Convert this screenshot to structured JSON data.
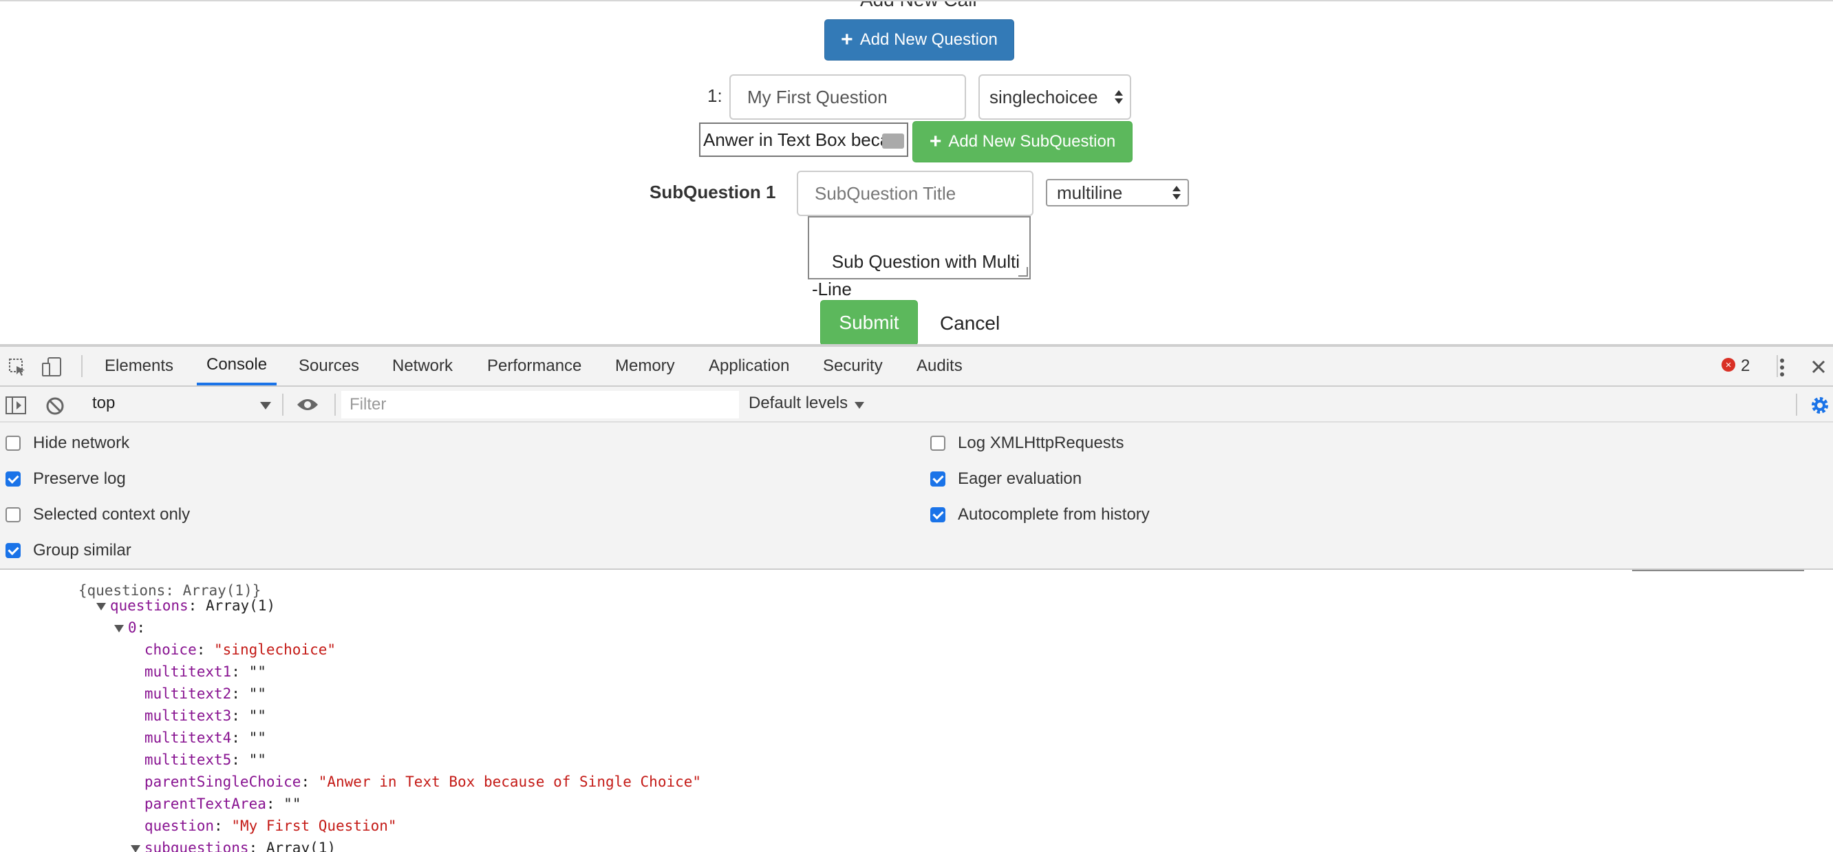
{
  "page": {
    "cut_heading": "Add New Call",
    "add_question_label": "Add New Question",
    "question_number": "1:",
    "question_title_value": "My First Question",
    "question_type_value": "singlechoicee",
    "answer_value": "Anwer in Text Box beca",
    "add_subquestion_label": "Add New SubQuestion",
    "subquestion_label": "SubQuestion 1",
    "subquestion_title_placeholder": "SubQuestion Title",
    "subquestion_type_value": "multiline",
    "subquestion_textarea_value": "Sub Question with Multi\n-Line",
    "submit_label": "Submit",
    "cancel_label": "Cancel"
  },
  "devtools": {
    "tabs": [
      "Elements",
      "Console",
      "Sources",
      "Network",
      "Performance",
      "Memory",
      "Application",
      "Security",
      "Audits"
    ],
    "active_tab": "Console",
    "error_count": "2",
    "context": "top",
    "filter_placeholder": "Filter",
    "levels": "Default levels",
    "settings_left": [
      {
        "label": "Hide network",
        "checked": false
      },
      {
        "label": "Preserve log",
        "checked": true
      },
      {
        "label": "Selected context only",
        "checked": false
      },
      {
        "label": "Group similar",
        "checked": true
      }
    ],
    "settings_right": [
      {
        "label": "Log XMLHttpRequests",
        "checked": false
      },
      {
        "label": "Eager evaluation",
        "checked": true
      },
      {
        "label": "Autocomplete from history",
        "checked": true
      }
    ],
    "console": {
      "cut_line": "{questions: Array(1)}",
      "questions_key": "questions",
      "questions_val": "Array(1)",
      "index_key": "0",
      "choice_key": "choice",
      "choice_val": "\"singlechoice\"",
      "mt1_key": "multitext1",
      "mt2_key": "multitext2",
      "mt3_key": "multitext3",
      "mt4_key": "multitext4",
      "mt5_key": "multitext5",
      "empty_val": "\"\"",
      "psc_key": "parentSingleChoice",
      "psc_val": "\"Anwer in Text Box because of Single Choice\"",
      "pta_key": "parentTextArea",
      "q_key": "question",
      "q_val": "\"My First Question\"",
      "subq_key": "subquestions",
      "subq_val": "Array(1)"
    }
  }
}
